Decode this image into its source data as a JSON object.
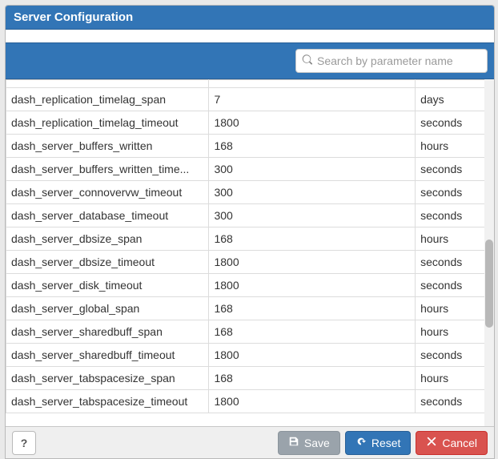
{
  "header": {
    "title": "Server Configuration"
  },
  "search": {
    "placeholder": "Search by parameter name",
    "value": ""
  },
  "table": {
    "truncated_top_name": "______________________________",
    "rows": [
      {
        "name": "dash_replication_timelag_span",
        "value": "7",
        "unit": "days"
      },
      {
        "name": "dash_replication_timelag_timeout",
        "value": "1800",
        "unit": "seconds"
      },
      {
        "name": "dash_server_buffers_written",
        "value": "168",
        "unit": "hours"
      },
      {
        "name": "dash_server_buffers_written_time...",
        "value": "300",
        "unit": "seconds"
      },
      {
        "name": "dash_server_connovervw_timeout",
        "value": "300",
        "unit": "seconds"
      },
      {
        "name": "dash_server_database_timeout",
        "value": "300",
        "unit": "seconds"
      },
      {
        "name": "dash_server_dbsize_span",
        "value": "168",
        "unit": "hours"
      },
      {
        "name": "dash_server_dbsize_timeout",
        "value": "1800",
        "unit": "seconds"
      },
      {
        "name": "dash_server_disk_timeout",
        "value": "1800",
        "unit": "seconds"
      },
      {
        "name": "dash_server_global_span",
        "value": "168",
        "unit": "hours"
      },
      {
        "name": "dash_server_sharedbuff_span",
        "value": "168",
        "unit": "hours"
      },
      {
        "name": "dash_server_sharedbuff_timeout",
        "value": "1800",
        "unit": "seconds"
      },
      {
        "name": "dash_server_tabspacesize_span",
        "value": "168",
        "unit": "hours"
      },
      {
        "name": "dash_server_tabspacesize_timeout",
        "value": "1800",
        "unit": "seconds"
      }
    ]
  },
  "footer": {
    "help": "?",
    "save": "Save",
    "reset": "Reset",
    "cancel": "Cancel"
  }
}
